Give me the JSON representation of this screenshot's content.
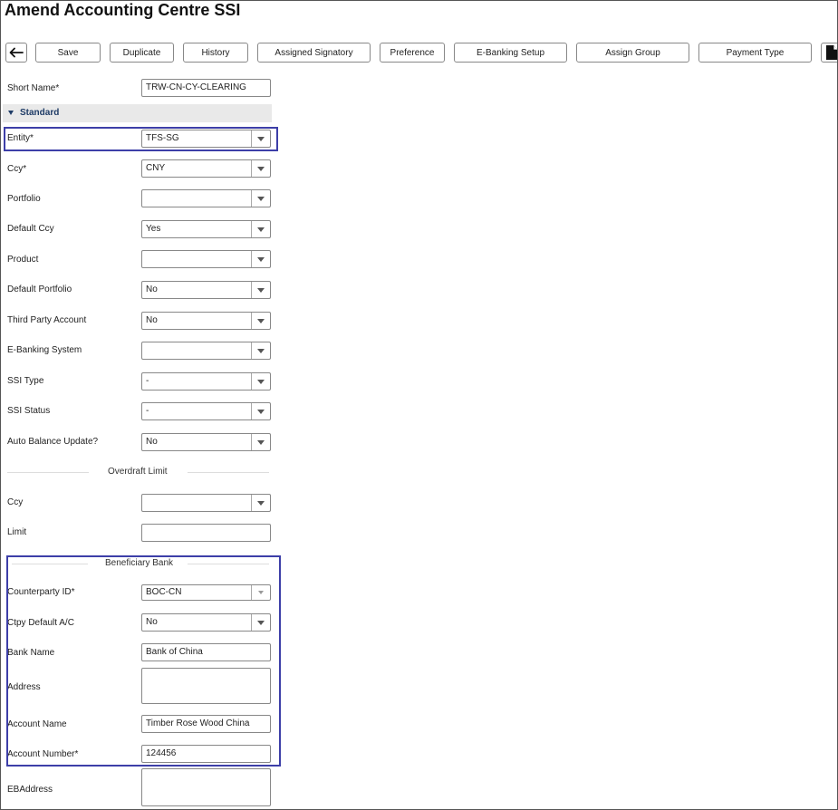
{
  "page": {
    "title": "Amend Accounting Centre SSI"
  },
  "toolbar": {
    "save": "Save",
    "duplicate": "Duplicate",
    "history": "History",
    "assigned_signatory": "Assigned Signatory",
    "preference": "Preference",
    "ebanking_setup": "E-Banking Setup",
    "assign_group": "Assign Group",
    "payment_type": "Payment Type"
  },
  "form": {
    "short_name": {
      "label": "Short Name*",
      "value": "TRW-CN-CY-CLEARING"
    },
    "standard_section": "Standard",
    "entity": {
      "label": "Entity*",
      "value": "TFS-SG"
    },
    "ccy": {
      "label": "Ccy*",
      "value": "CNY"
    },
    "portfolio": {
      "label": "Portfolio",
      "value": ""
    },
    "default_ccy": {
      "label": "Default Ccy",
      "value": "Yes"
    },
    "product": {
      "label": "Product",
      "value": ""
    },
    "default_portfolio": {
      "label": "Default Portfolio",
      "value": "No"
    },
    "third_party_account": {
      "label": "Third Party Account",
      "value": "No"
    },
    "ebanking_system": {
      "label": "E-Banking System",
      "value": ""
    },
    "ssi_type": {
      "label": "SSI Type",
      "value": "-"
    },
    "ssi_status": {
      "label": "SSI Status",
      "value": "-"
    },
    "auto_balance_update": {
      "label": "Auto Balance Update?",
      "value": "No"
    },
    "overdraft_limit": {
      "heading": "Overdraft Limit",
      "ccy": {
        "label": "Ccy",
        "value": ""
      },
      "limit": {
        "label": "Limit",
        "value": ""
      }
    },
    "beneficiary_bank": {
      "heading": "Beneficiary Bank",
      "counterparty_id": {
        "label": "Counterparty ID*",
        "value": "BOC-CN"
      },
      "ctpy_default_ac": {
        "label": "Ctpy Default A/C",
        "value": "No"
      },
      "bank_name": {
        "label": "Bank Name",
        "value": "Bank of China"
      },
      "address": {
        "label": "Address",
        "value": ""
      },
      "account_name": {
        "label": "Account Name",
        "value": "Timber Rose Wood China"
      },
      "account_number": {
        "label": "Account Number*",
        "value": "124456"
      }
    },
    "ebaddress": {
      "label": "EBAddress",
      "value": ""
    }
  },
  "colors": {
    "highlight": "#3d3fa8",
    "section_text": "#1e3b66",
    "section_bg": "#e9e9e9"
  },
  "icons": {
    "back": "arrow-left-icon",
    "document": "document-icon",
    "dropdown": "chevron-down-icon",
    "section": "triangle-down-icon"
  }
}
